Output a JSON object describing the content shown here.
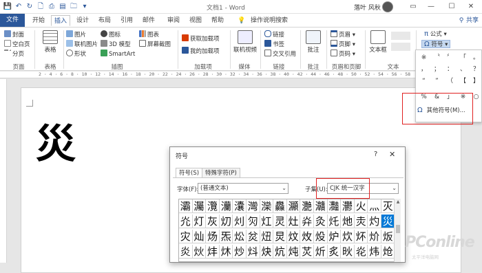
{
  "title_bar": {
    "doc_title": "文档1 - Word",
    "user_name": "落叶 风秋",
    "quick_access": [
      "save-icon",
      "undo-icon",
      "redo-icon",
      "new-doc-icon",
      "print-icon",
      "open-icon",
      "folder-icon",
      "customize-icon"
    ],
    "window_controls": [
      "ribbon-options-icon",
      "minimize-icon",
      "maximize-icon",
      "close-icon"
    ]
  },
  "tabs": [
    "文件",
    "开始",
    "插入",
    "设计",
    "布局",
    "引用",
    "邮件",
    "审阅",
    "视图",
    "帮助",
    "操作说明搜索"
  ],
  "share_label": "共享",
  "ribbon": {
    "pages_group": {
      "items": [
        "封面",
        "空白页",
        "分页"
      ],
      "label": "页面"
    },
    "tables_group": {
      "item": "表格",
      "label": "表格"
    },
    "illustrations_group": {
      "items": [
        "图片",
        "联机图片",
        "形状",
        "图标",
        "3D 模型",
        "SmartArt",
        "图表",
        "屏幕截图"
      ],
      "label": "插图"
    },
    "addins_group": {
      "items": [
        "获取加载项",
        "我的加载项"
      ],
      "label": "加载项"
    },
    "media_group": {
      "item": "联机视频",
      "label": "媒体"
    },
    "links_group": {
      "items": [
        "链接",
        "书签",
        "交叉引用"
      ],
      "label": "链接"
    },
    "comments_group": {
      "item": "批注",
      "label": "批注"
    },
    "header_footer_group": {
      "items": [
        "页眉",
        "页脚",
        "页码"
      ],
      "label": "页眉和页脚"
    },
    "text_group": {
      "item": "文本框",
      "label": "文本"
    },
    "symbols_group": {
      "items": [
        "公式",
        "符号"
      ]
    }
  },
  "symbol_dropdown": {
    "rows": [
      [
        "※",
        "〝",
        "〞",
        "「",
        "。"
      ],
      [
        "，",
        "；",
        "：",
        "、",
        "？"
      ],
      [
        "“",
        "”",
        "（",
        "【",
        "】"
      ],
      [
        "%",
        "&",
        "」",
        "※",
        "○"
      ]
    ],
    "more_label": "其他符号(M)..."
  },
  "document": {
    "big_char": "災"
  },
  "dialog": {
    "title": "符号",
    "help": "?",
    "close": "✕",
    "tab_symbols": "符号(S)",
    "tab_special": "特殊字符(P)",
    "font_label": "字体(F):",
    "font_value": "(普通文本)",
    "subset_label": "子集(U):",
    "subset_value": "CJK 统一汉字",
    "grid": [
      [
        "灞",
        "灟",
        "灠",
        "灡",
        "灢",
        "灣",
        "灤",
        "灥",
        "灦",
        "灧",
        "灨",
        "灩",
        "灪",
        "火",
        "灬",
        "灭"
      ],
      [
        "灮",
        "灯",
        "灰",
        "灱",
        "灲",
        "灳",
        "灴",
        "灵",
        "灶",
        "灷",
        "灸",
        "灹",
        "灺",
        "灻",
        "灼",
        "災"
      ],
      [
        "灾",
        "灿",
        "炀",
        "炁",
        "炂",
        "炃",
        "炄",
        "炅",
        "炆",
        "炇",
        "炈",
        "炉",
        "炊",
        "炋",
        "炌",
        "炍"
      ],
      [
        "炎",
        "炏",
        "炐",
        "炑",
        "炒",
        "炓",
        "炔",
        "炕",
        "炖",
        "炗",
        "炘",
        "炙",
        "炚",
        "炛",
        "炜",
        "炝"
      ]
    ],
    "selected": "災"
  },
  "watermark": {
    "main": "PConline",
    "sub": "太平洋电脑网"
  }
}
